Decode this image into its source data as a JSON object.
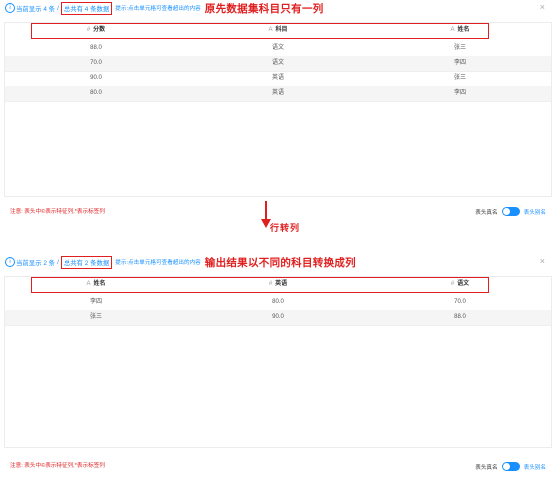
{
  "top": {
    "info_text": "当前显示 4 条",
    "separator": "/",
    "total_text": "总共有 4 条数据",
    "hint_text": "提示:点击单元格可查看超出的内容",
    "annotation": "原先数据集科目只有一列",
    "close_label": "×",
    "columns": [
      {
        "icon": "#",
        "label": "分数"
      },
      {
        "icon": "A",
        "label": "科目"
      },
      {
        "icon": "A",
        "label": "姓名"
      }
    ],
    "rows": [
      [
        "88.0",
        "语文",
        "张三"
      ],
      [
        "70.0",
        "语文",
        "李四"
      ],
      [
        "90.0",
        "英语",
        "张三"
      ],
      [
        "80.0",
        "英语",
        "李四"
      ]
    ],
    "footer_note": "注意: 表头中©表示特征列,*表示标签列",
    "switch_label": "表头真名",
    "switch_on_label": "表头别名"
  },
  "middle": {
    "arrow_label": "行转列"
  },
  "bottom": {
    "info_text": "当前显示 2 条",
    "separator": "/",
    "total_text": "总共有 2 条数据",
    "hint_text": "提示:点击单元格可查看超出的内容",
    "annotation": "输出结果以不同的科目转换成列",
    "close_label": "×",
    "columns": [
      {
        "icon": "A",
        "label": "姓名"
      },
      {
        "icon": "#",
        "label": "英语"
      },
      {
        "icon": "#",
        "label": "语文"
      }
    ],
    "rows": [
      [
        "李四",
        "80.0",
        "70.0"
      ],
      [
        "张三",
        "90.0",
        "88.0"
      ]
    ],
    "footer_note": "注意: 表头中©表示特征列,*表示标签列",
    "switch_label": "表头真名",
    "switch_on_label": "表头别名"
  },
  "colors": {
    "accent": "#1890ff",
    "annotation": "#e02020",
    "row_alt": "#f5f5f5"
  }
}
